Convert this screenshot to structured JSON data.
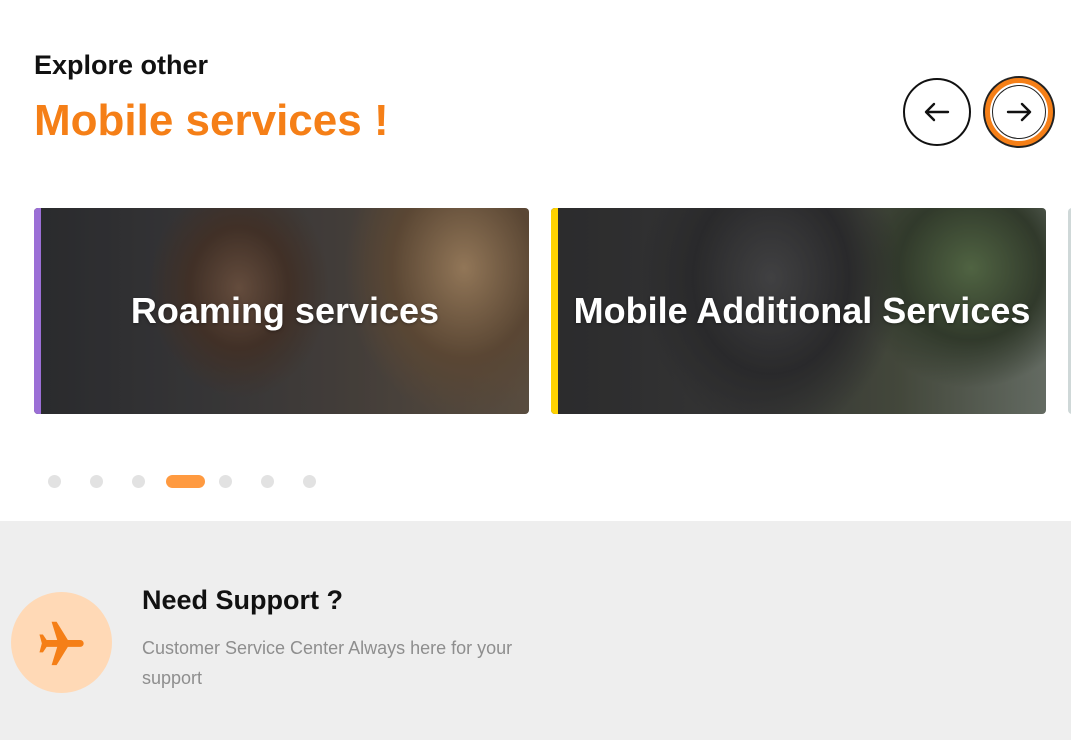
{
  "header": {
    "eyebrow": "Explore other",
    "headline": "Mobile services !"
  },
  "carousel": {
    "prev_icon": "arrow-left-icon",
    "next_icon": "arrow-right-icon",
    "cards": [
      {
        "title": "Roaming services",
        "accent": "#9b6fd6"
      },
      {
        "title": "Mobile Additional Services",
        "accent": "#ffd200"
      }
    ],
    "dots_count": 7,
    "active_dot": 4
  },
  "support": {
    "icon": "airplane-icon",
    "title": "Need Support ?",
    "description": "Customer Service Center Always here for your support"
  },
  "colors": {
    "brand_orange": "#f57f17",
    "active_dot": "#ff9a40",
    "support_bg": "#eeeeee",
    "support_icon_bg": "#ffd9b6"
  }
}
